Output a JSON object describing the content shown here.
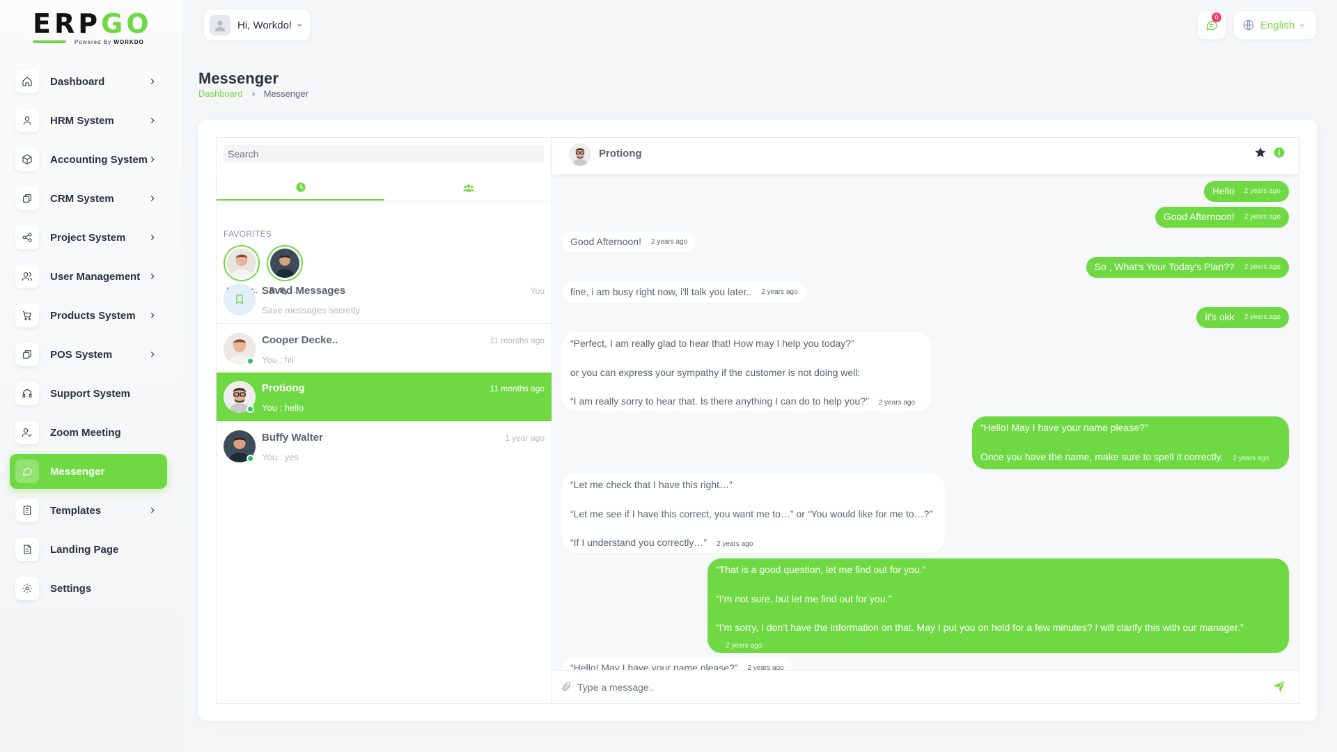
{
  "brand": {
    "logo_main": "ERP",
    "logo_accent": "GO",
    "powered_by": "Powered By",
    "powered_brand": "WORKDO"
  },
  "sidebar": {
    "items": [
      {
        "label": "Dashboard",
        "icon": "home-icon",
        "has_submenu": true
      },
      {
        "label": "HRM System",
        "icon": "user-icon",
        "has_submenu": true
      },
      {
        "label": "Accounting System",
        "icon": "box-icon",
        "has_submenu": true
      },
      {
        "label": "CRM System",
        "icon": "layers-icon",
        "has_submenu": true
      },
      {
        "label": "Project System",
        "icon": "share-icon",
        "has_submenu": true
      },
      {
        "label": "User Management",
        "icon": "users-icon",
        "has_submenu": true
      },
      {
        "label": "Products System",
        "icon": "cart-icon",
        "has_submenu": true
      },
      {
        "label": "POS System",
        "icon": "layers-icon",
        "has_submenu": true
      },
      {
        "label": "Support System",
        "icon": "headphones-icon",
        "has_submenu": false
      },
      {
        "label": "Zoom Meeting",
        "icon": "user-check-icon",
        "has_submenu": false
      },
      {
        "label": "Messenger",
        "icon": "message-icon",
        "has_submenu": false,
        "active": true
      },
      {
        "label": "Templates",
        "icon": "file-icon",
        "has_submenu": true
      },
      {
        "label": "Landing Page",
        "icon": "file-text-icon",
        "has_submenu": false
      },
      {
        "label": "Settings",
        "icon": "settings-icon",
        "has_submenu": false
      }
    ]
  },
  "header": {
    "greeting": "Hi, Workdo!",
    "notification_count": "0",
    "language": "English"
  },
  "page": {
    "title": "Messenger",
    "breadcrumb_root": "Dashboard",
    "breadcrumb_current": "Messenger"
  },
  "contacts_panel": {
    "search_placeholder": "Search",
    "favorites_label": "FAVORITES",
    "favorites": [
      {
        "name": "Cooper.."
      },
      {
        "name": "Buffy .."
      }
    ],
    "saved": {
      "name": "Saved Messages",
      "meta": "You",
      "preview": "Save messages secretly"
    },
    "contacts": [
      {
        "name": "Cooper Decke..",
        "time": "11 months ago",
        "preview": "You : hii"
      },
      {
        "name": "Protiong",
        "time": "11 months ago",
        "preview": "You : hello",
        "active": true
      },
      {
        "name": "Buffy Walter",
        "time": "1 year ago",
        "preview": "You : yes"
      }
    ]
  },
  "chat": {
    "contact_name": "Protiong",
    "composer_placeholder": "Type a message..",
    "messages": [
      {
        "dir": "out",
        "lines": [
          "Hello"
        ],
        "time": "2 years ago"
      },
      {
        "dir": "out",
        "lines": [
          "Good Afternoon!"
        ],
        "time": "2 years ago"
      },
      {
        "dir": "in",
        "lines": [
          "Good Afternoon!"
        ],
        "time": "2 years ago"
      },
      {
        "dir": "out",
        "lines": [
          "So , What's Your Today's Plan??"
        ],
        "time": "2 years ago"
      },
      {
        "dir": "in",
        "lines": [
          "fine, i am busy right now, i'll talk you later.."
        ],
        "time": "2 years ago"
      },
      {
        "dir": "out",
        "lines": [
          "it's okk"
        ],
        "time": "2 years ago"
      },
      {
        "dir": "in",
        "lines": [
          "“Perfect, I am really glad to hear that! How may I help you today?”",
          "or you can express your sympathy if the customer is not doing well:",
          "“I am really sorry to hear that. Is there anything I can do to help you?”"
        ],
        "time": "2 years ago"
      },
      {
        "dir": "out",
        "lines": [
          "“Hello! May I have your name please?”",
          "Once you have the name, make sure to spell it correctly."
        ],
        "time": "2 years ago"
      },
      {
        "dir": "in",
        "lines": [
          "“Let me check that I have this right…”",
          "“Let me see if I have this correct, you want me to…” or “You would like for me to…?”",
          "“If I understand you correctly…”"
        ],
        "time": "2 years ago"
      },
      {
        "dir": "out",
        "lines": [
          "“That is a good question, let me find out for you.”",
          "“I’m not sure, but let me find out for you.”",
          "“I’m sorry, I don’t have the information on that. May I put you on hold for a few minutes? I will clarify this with our manager.”"
        ],
        "time": "2 years ago"
      },
      {
        "dir": "in",
        "lines": [
          "“Hello! May I have your name please?”"
        ],
        "time": "2 years ago"
      }
    ]
  },
  "colors": {
    "accent": "#6fd943",
    "text": "#293240",
    "muted": "#b4b9c2",
    "badge": "#ff3a6e"
  }
}
